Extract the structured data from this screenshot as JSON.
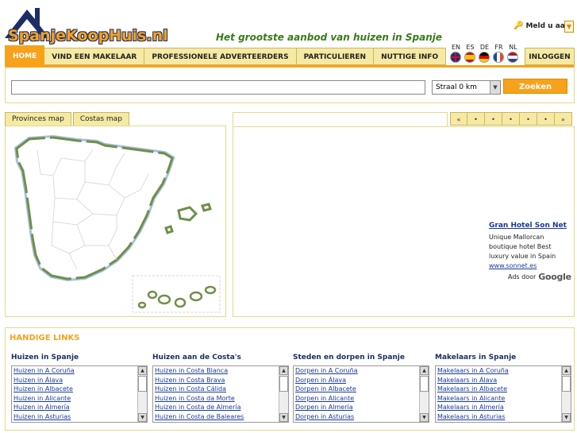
{
  "header": {
    "logo_text": "SpanjeKoopHuis.nl",
    "tagline": "Het grootste aanbod van huizen in Spanje",
    "login_link": "Meld u aan!"
  },
  "nav": {
    "items": [
      {
        "label": "HOME",
        "active": true
      },
      {
        "label": "VIND EEN MAKELAAR",
        "active": false
      },
      {
        "label": "PROFESSIONELE ADVERTEERDERS",
        "active": false
      },
      {
        "label": "PARTICULIEREN",
        "active": false
      },
      {
        "label": "NUTTIGE INFO",
        "active": false
      }
    ],
    "login_tab": "INLOGGEN",
    "languages": [
      {
        "code": "EN",
        "flag": "flag-en"
      },
      {
        "code": "ES",
        "flag": "flag-es"
      },
      {
        "code": "DE",
        "flag": "flag-de"
      },
      {
        "code": "FR",
        "flag": "flag-fr"
      },
      {
        "code": "NL",
        "flag": "flag-nl"
      }
    ]
  },
  "search": {
    "query": "",
    "radius_value": "Straal 0 km",
    "button_label": "Zoeken"
  },
  "map_panel": {
    "tabs": [
      "Provinces map",
      "Costas map"
    ]
  },
  "ad_panel": {
    "pager": [
      "«",
      "•",
      "•",
      "•",
      "•",
      "•",
      "»"
    ],
    "ad": {
      "title": "Gran Hotel Son Net",
      "body": "Unique Mallorcan boutique hotel Best luxury value in Spain",
      "url": "www.sonnet.es"
    },
    "ads_by": "Ads door",
    "ads_brand": "Google"
  },
  "links": {
    "title": "HANDIGE LINKS",
    "columns": [
      {
        "title": "Huizen in Spanje",
        "items": [
          "Huizen in A Coruña",
          "Huizen in Álava",
          "Huizen in Albacete",
          "Huizen in Alicante",
          "Huizen in Almería",
          "Huizen in Asturias"
        ]
      },
      {
        "title": "Huizen aan de Costa's",
        "items": [
          "Huizen in Costa Blanca",
          "Huizen in Costa Brava",
          "Huizen in Costa Cálida",
          "Huizen in Costa da Morte",
          "Huizen in Costa de Almería",
          "Huizen in Costa de Baleares"
        ]
      },
      {
        "title": "Steden en dorpen in Spanje",
        "items": [
          "Dorpen in A Coruña",
          "Dorpen in Álava",
          "Dorpen in Albacete",
          "Dorpen in Alicante",
          "Dorpen in Almería",
          "Dorpen in Asturias"
        ]
      },
      {
        "title": "Makelaars in Spanje",
        "items": [
          "Makelaars in A Coruña",
          "Makelaars in Álava",
          "Makelaars in Albacete",
          "Makelaars in Alicante",
          "Makelaars in Almería",
          "Makelaars in Asturias"
        ]
      }
    ]
  },
  "colors": {
    "accent": "#f7a21b",
    "nav_bg": "#f5e9a4",
    "tagline": "#3a7a1a",
    "link": "#1a3a9a"
  }
}
